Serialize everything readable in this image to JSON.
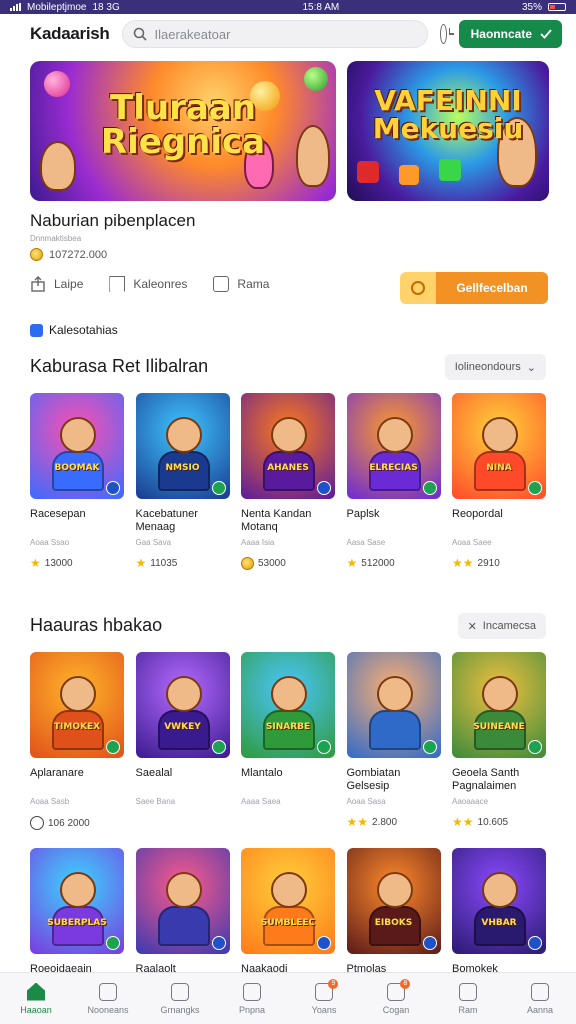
{
  "status_bar": {
    "carrier": "Mobileptjmoe",
    "network": "18 3G",
    "time": "15:8 AM",
    "battery": "35%"
  },
  "header": {
    "brand": "Kadaarish",
    "search_placeholder": "Ilaerakeatoar",
    "cta_label": "Haonncate",
    "icons": {
      "search": "search-icon",
      "history": "clock-icon",
      "cta": "check-icon"
    }
  },
  "banners": [
    {
      "title_line1": "Tluraan",
      "title_line2": "Riegnica",
      "colors": [
        "#ff8a2a",
        "#9a2bd1"
      ]
    },
    {
      "title_line1": "VAFEINNI",
      "title_line2": "Mekuesiu",
      "colors": [
        "#2b9ae6",
        "#4a1b9e"
      ]
    }
  ],
  "feature": {
    "title": "Naburian pibenplacen",
    "subtitle": "Dnnmaktisbea",
    "price": "107272.000",
    "actions": [
      {
        "label": "Laipe",
        "icon": "share-icon"
      },
      {
        "label": "Kaleonres",
        "icon": "bookmark-icon"
      },
      {
        "label": "Rama",
        "icon": "comment-icon"
      }
    ],
    "primary_button": "Gellfecelban"
  },
  "category_tag": "Kalesotahias",
  "sections": [
    {
      "title": "Kaburasa Ret Ilibalran",
      "button_label": "Iolineondours",
      "items": [
        {
          "name": "Racesepan",
          "meta": "Aoaa Ssao",
          "price": "13000",
          "price_icon": "star",
          "tag": "BOOMAK",
          "c1": "#ff4fb0",
          "c2": "#3a6bff",
          "badge": "blue"
        },
        {
          "name": "Kacebatuner Menaag",
          "meta": "Gaa Sava",
          "price": "11035",
          "price_icon": "star",
          "tag": "NMSIO",
          "c1": "#3ec6ff",
          "c2": "#1a3a8f",
          "badge": "green"
        },
        {
          "name": "Nenta Kandan Motanq",
          "meta": "Aaaa Isia",
          "price": "53000",
          "price_icon": "coin",
          "tag": "AHANES",
          "c1": "#ff7a1a",
          "c2": "#5a1a9e",
          "badge": "blue"
        },
        {
          "name": "Paplsk",
          "meta": "Aasa Sase",
          "price": "512000",
          "price_icon": "star",
          "tag": "ELRECIAS",
          "c1": "#ff9b2a",
          "c2": "#6a2ad6",
          "badge": "green"
        },
        {
          "name": "Reopordal",
          "meta": "Aoaa Saee",
          "price": "2910",
          "price_icon": "stars",
          "tag": "NINA",
          "c1": "#ffd23a",
          "c2": "#ff4a2a",
          "badge": "green"
        }
      ]
    },
    {
      "title": "Haauras hbakao",
      "button_label": "Incamecsa",
      "items": [
        {
          "name": "Aplaranare",
          "meta": "Aoaa Sasb",
          "price": "106 2000",
          "price_icon": "timer",
          "tag": "TIMOKEX",
          "c1": "#ffb52a",
          "c2": "#e0501a",
          "badge": "green"
        },
        {
          "name": "Saealal",
          "meta": "Saee Bana",
          "price": "",
          "price_icon": "none",
          "tag": "VWKEY",
          "c1": "#b66bff",
          "c2": "#3a1a8f",
          "badge": "green"
        },
        {
          "name": "Mlantalo",
          "meta": "Aaaa Saea",
          "price": "",
          "price_icon": "none",
          "tag": "SINARBE",
          "c1": "#4ac6ff",
          "c2": "#2f9a3a",
          "badge": "green"
        },
        {
          "name": "Gombiatan Gelsesip",
          "meta": "Aoaa Sasa",
          "price": "2.800",
          "price_icon": "stars",
          "tag": "",
          "c1": "#ffb070",
          "c2": "#2f6ac9",
          "badge": "green"
        },
        {
          "name": "Geoela Santh Pagnalaimen",
          "meta": "Aaoaaace",
          "price": "10.605",
          "price_icon": "stars",
          "tag": "SUINEANE",
          "c1": "#f0c040",
          "c2": "#3a8a3a",
          "badge": "green"
        }
      ]
    },
    {
      "title": "",
      "button_label": "",
      "items": [
        {
          "name": "Roeoidaeain",
          "meta": "",
          "price": "",
          "price_icon": "none",
          "tag": "SUBERPLAS",
          "c1": "#3ad6ff",
          "c2": "#7a3adf",
          "badge": "green"
        },
        {
          "name": "Raalaolt",
          "meta": "",
          "price": "",
          "price_icon": "none",
          "tag": "",
          "c1": "#ff5a8a",
          "c2": "#3a3aaf",
          "badge": "blue"
        },
        {
          "name": "Naakaodi",
          "meta": "",
          "price": "",
          "price_icon": "none",
          "tag": "SUMBLEEC",
          "c1": "#ffcf3a",
          "c2": "#ff7a1a",
          "badge": "blue"
        },
        {
          "name": "Ptmolas",
          "meta": "",
          "price": "",
          "price_icon": "none",
          "tag": "EIBOKS",
          "c1": "#ff8a2a",
          "c2": "#5a1a1a",
          "badge": "blue"
        },
        {
          "name": "Bomokek",
          "meta": "",
          "price": "",
          "price_icon": "none",
          "tag": "VHBAR",
          "c1": "#8a4aff",
          "c2": "#2a1a6f",
          "badge": "blue"
        }
      ]
    }
  ],
  "bottom_nav": [
    {
      "label": "Haaoan",
      "icon": "home-icon",
      "active": true,
      "badge": ""
    },
    {
      "label": "Nooneans",
      "icon": "tools-icon",
      "active": false,
      "badge": ""
    },
    {
      "label": "Grnangks",
      "icon": "search-icon",
      "active": false,
      "badge": ""
    },
    {
      "label": "Pnpna",
      "icon": "chat-icon",
      "active": false,
      "badge": ""
    },
    {
      "label": "Yoans",
      "icon": "bell-icon",
      "active": false,
      "badge": "9"
    },
    {
      "label": "Cogan",
      "icon": "calendar-icon",
      "active": false,
      "badge": "8"
    },
    {
      "label": "Ram",
      "icon": "message-icon",
      "active": false,
      "badge": ""
    },
    {
      "label": "Aanna",
      "icon": "profile-icon",
      "active": false,
      "badge": ""
    }
  ]
}
